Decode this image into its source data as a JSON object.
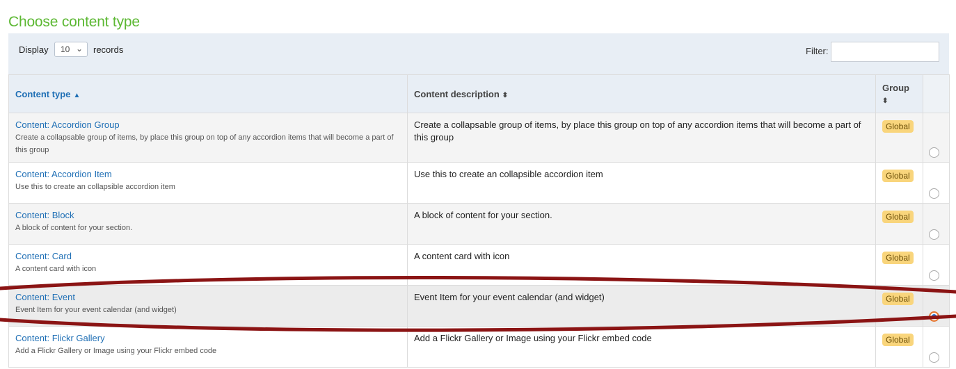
{
  "page": {
    "title": "Choose content type"
  },
  "toolbar": {
    "display_label": "Display",
    "page_size": "10",
    "records_label": "records",
    "filter_label": "Filter:",
    "filter_value": ""
  },
  "table": {
    "headers": {
      "content_type": "Content type",
      "content_description": "Content description",
      "group": "Group"
    },
    "sort": {
      "column": "content_type",
      "direction": "asc"
    },
    "rows": [
      {
        "title": "Content: Accordion Group",
        "subtitle": "Create a collapsable group of items, by place this group on top of any accordion items that will become a part of this group",
        "description": "Create a collapsable group of items, by place this group on top of any accordion items that will become a part of this group",
        "group": "Global",
        "selected": false
      },
      {
        "title": "Content: Accordion Item",
        "subtitle": "Use this to create an collapsible accordion item",
        "description": "Use this to create an collapsible accordion item",
        "group": "Global",
        "selected": false
      },
      {
        "title": "Content: Block",
        "subtitle": "A block of content for your section.",
        "description": "A block of content for your section.",
        "group": "Global",
        "selected": false
      },
      {
        "title": "Content: Card",
        "subtitle": "A content card with icon",
        "description": "A content card with icon",
        "group": "Global",
        "selected": false
      },
      {
        "title": "Content: Event",
        "subtitle": "Event Item for your event calendar (and widget)",
        "description": "Event Item for your event calendar (and widget)",
        "group": "Global",
        "selected": true
      },
      {
        "title": "Content: Flickr Gallery",
        "subtitle": "Add a Flickr Gallery or Image using your Flickr embed code",
        "description": "Add a Flickr Gallery or Image using your Flickr embed code",
        "group": "Global",
        "selected": false
      }
    ]
  },
  "colors": {
    "title_green": "#5cb833",
    "link_blue": "#1f6fb5",
    "badge_bg": "#f9d57c",
    "annotation": "#8b1414"
  },
  "icons": {
    "sort_asc": "caret-up-icon",
    "sort_both": "sort-icon",
    "select_chevron": "chevron-down-icon"
  }
}
